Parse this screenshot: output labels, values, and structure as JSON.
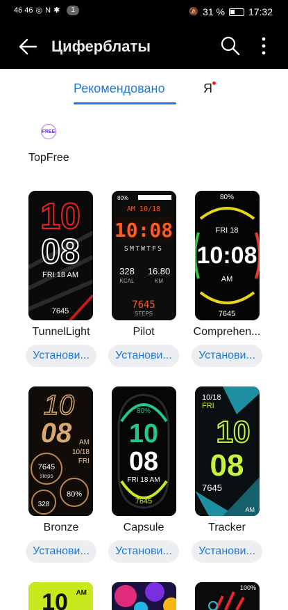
{
  "status_bar": {
    "signal_text": "46 46",
    "notification_count": "1",
    "battery_percent": "31 %",
    "time": "17:32"
  },
  "app_bar": {
    "title": "Циферблаты",
    "back_icon": "arrow-left-icon",
    "search_icon": "search-icon",
    "more_icon": "more-vertical-icon"
  },
  "tabs": {
    "active": "Рекомендовано",
    "second": "Я"
  },
  "collection": {
    "icon_text": "FREE",
    "label": "TopFree"
  },
  "install_label": "Установи...",
  "cards": [
    {
      "name": "TunnelLight",
      "top_digits": "10",
      "bottom_digits": "08",
      "date": "FRI 18 AM",
      "steps": "7645"
    },
    {
      "name": "Pilot",
      "battery": "80%",
      "date": "AM 10/18",
      "time": "10:08",
      "weekdays": "SMTWTFS",
      "kcal": "328",
      "kcal_label": "KCAL",
      "km": "16.80",
      "km_label": "KM",
      "steps": "7645",
      "steps_label": "STEPS"
    },
    {
      "name": "Comprehen...",
      "battery": "80%",
      "date": "FRI 18",
      "time": "10:08",
      "ampm": "AM",
      "steps": "7645"
    },
    {
      "name": "Bronze",
      "top_digits": "10",
      "bottom_digits": "08",
      "ampm": "AM",
      "date": "10/18",
      "day": "FRI",
      "steps": "7645",
      "steps_label": "steps",
      "kcal": "328",
      "battery": "80%"
    },
    {
      "name": "Capsule",
      "battery": "80%",
      "top_digits": "10",
      "bottom_digits": "08",
      "date": "FRI 18 AM",
      "steps": "7645"
    },
    {
      "name": "Tracker",
      "date": "10/18",
      "day": "FRI",
      "top_digits": "10",
      "bottom_digits": "08",
      "steps": "7645",
      "ampm": "AM"
    }
  ],
  "partial_row": {
    "first": {
      "top_digits": "10",
      "ampm": "AM"
    },
    "third": {
      "battery": "100%"
    }
  }
}
